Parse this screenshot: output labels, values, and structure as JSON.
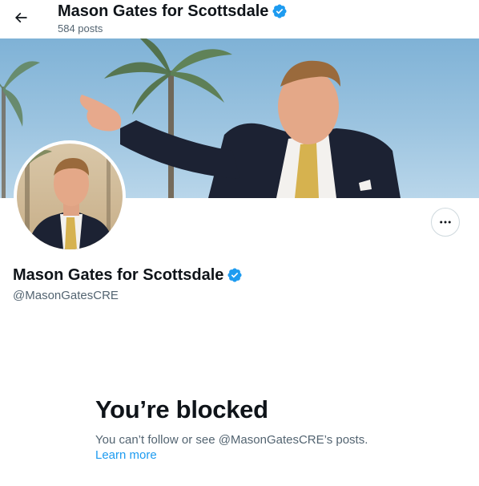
{
  "header": {
    "back_icon": "arrow-left-icon",
    "title": "Mason Gates for Scottsdale",
    "post_count": "584 posts",
    "verified_icon": "verified-badge-icon"
  },
  "profile": {
    "name": "Mason Gates for Scottsdale",
    "handle": "@MasonGatesCRE",
    "more_icon": "more-options-icon"
  },
  "blocked": {
    "title": "You’re blocked",
    "message": "You can’t follow or see @MasonGatesCRE’s posts.",
    "learn_more": "Learn more"
  },
  "colors": {
    "text_primary": "#0f1419",
    "text_secondary": "#536471",
    "accent": "#1d9bf0",
    "border": "#cfd9de"
  }
}
